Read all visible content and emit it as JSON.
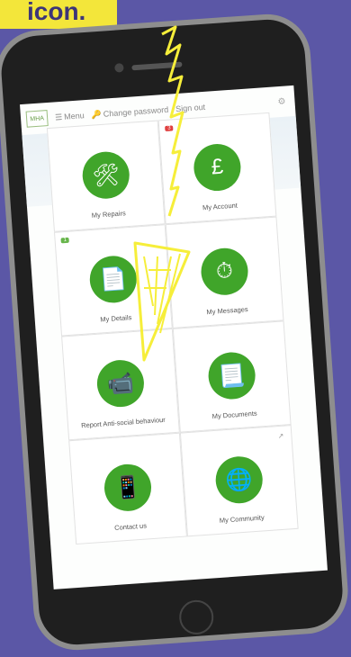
{
  "caption": "icon.",
  "nav": {
    "menu": "Menu",
    "change_password": "Change password",
    "sign_out": "Sign out"
  },
  "tiles": [
    {
      "label": "My Repairs",
      "icon": "tools-icon"
    },
    {
      "label": "My Account",
      "icon": "pound-house-icon",
      "badge": "3"
    },
    {
      "label": "My Details",
      "icon": "document-user-icon",
      "badge": "1"
    },
    {
      "label": "My Messages",
      "icon": "stopwatch-icon"
    },
    {
      "label": "Report Anti-social behaviour",
      "icon": "cctv-camera-icon"
    },
    {
      "label": "My Documents",
      "icon": "document-icon"
    },
    {
      "label": "Contact us",
      "icon": "phone-chat-icon"
    },
    {
      "label": "My Community",
      "icon": "globe-people-icon"
    }
  ],
  "colors": {
    "background": "#5b57a6",
    "accent_green": "#40a52a",
    "caption_yellow": "#f3e63a",
    "scribble_yellow": "#f6ee3a"
  }
}
